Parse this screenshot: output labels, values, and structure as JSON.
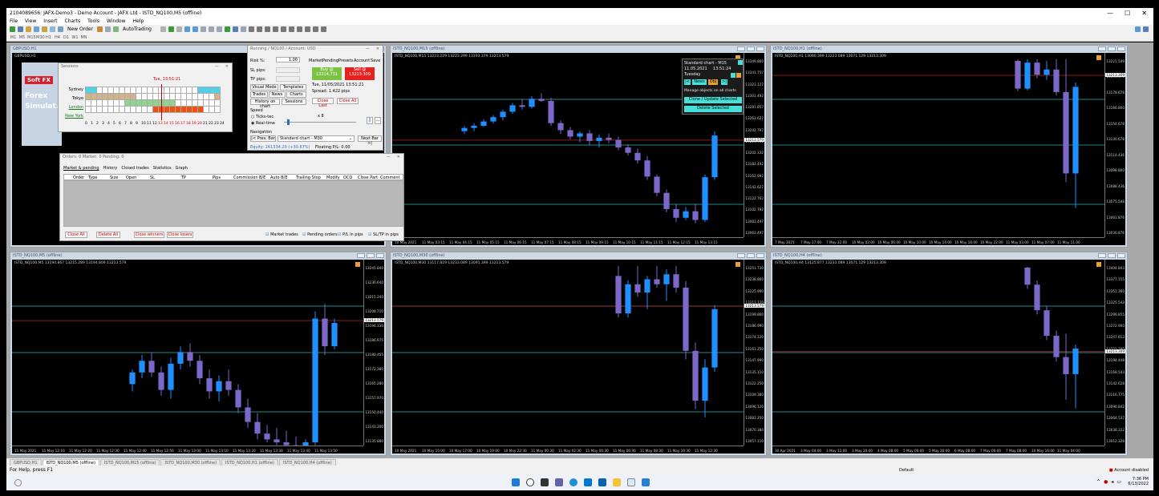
{
  "window": {
    "title": "2104089656: JAFX-Demo3 - Demo Account - JAFX Ltd - ISTD_NQ100,M5 (offline)",
    "btn_min": "—",
    "btn_max": "☐",
    "btn_close": "✕"
  },
  "menu": [
    "File",
    "View",
    "Insert",
    "Charts",
    "Tools",
    "Window",
    "Help"
  ],
  "toolbar": {
    "new_order": "New Order",
    "autotrading": "AutoTrading",
    "timeframes": [
      "M1",
      "M5",
      "M15",
      "M30",
      "H1",
      "H4",
      "D1",
      "W1",
      "MN"
    ]
  },
  "charts": [
    {
      "id": "gbpusd",
      "title": "GBPUSD,H1",
      "label": "GBPUSD,H1"
    },
    {
      "id": "m15",
      "title": "ISTD_NQ100,M15 (offline)",
      "label": "ISTD_NQ100,M15 13223.229 13223.299 13193.379 13213.579",
      "prices": [
        "13349.860",
        "13341.757",
        "13323.127",
        "13301.492",
        "13281.857",
        "13263.627",
        "13242.797",
        "13221.762",
        "13202.332",
        "13182.492",
        "13162.992",
        "13142.627",
        "13122.762",
        "13102.792",
        "13083.497",
        "13063.497"
      ],
      "current_price": "13213.579",
      "times": [
        "10 May 2021",
        "11 May 03:15",
        "11 May 04:15",
        "11 May 05:15",
        "11 May 06:15",
        "11 May 07:15",
        "11 May 08:15",
        "11 May 09:15",
        "11 May 10:15",
        "11 May 11:15",
        "11 May 12:15",
        "11 May 13:15"
      ],
      "y_min": 13040,
      "y_max": 13360,
      "candles": [
        [
          13230,
          13240,
          13225,
          13236
        ],
        [
          13236,
          13245,
          13230,
          13240
        ],
        [
          13240,
          13252,
          13238,
          13248
        ],
        [
          13248,
          13260,
          13244,
          13256
        ],
        [
          13256,
          13270,
          13250,
          13266
        ],
        [
          13266,
          13282,
          13262,
          13278
        ],
        [
          13278,
          13290,
          13270,
          13275
        ],
        [
          13275,
          13295,
          13272,
          13290
        ],
        [
          13290,
          13300,
          13284,
          13286
        ],
        [
          13286,
          13292,
          13240,
          13245
        ],
        [
          13245,
          13250,
          13225,
          13232
        ],
        [
          13232,
          13238,
          13215,
          13220
        ],
        [
          13220,
          13230,
          13210,
          13226
        ],
        [
          13226,
          13232,
          13205,
          13212
        ],
        [
          13212,
          13224,
          13200,
          13218
        ],
        [
          13218,
          13226,
          13208,
          13214
        ],
        [
          13214,
          13220,
          13195,
          13200
        ],
        [
          13200,
          13206,
          13185,
          13190
        ],
        [
          13190,
          13198,
          13170,
          13176
        ],
        [
          13176,
          13184,
          13140,
          13146
        ],
        [
          13146,
          13150,
          13110,
          13116
        ],
        [
          13116,
          13122,
          13080,
          13086
        ],
        [
          13086,
          13094,
          13062,
          13070
        ],
        [
          13070,
          13090,
          13066,
          13082
        ],
        [
          13082,
          13096,
          13060,
          13066
        ],
        [
          13066,
          13150,
          13062,
          13145
        ],
        [
          13145,
          13230,
          13140,
          13222
        ]
      ]
    },
    {
      "id": "h1",
      "title": "ISTD_NQ100,H1 (offline)",
      "label": "ISTD_NQ100,H1 13090.399 13223.089 13071.129 13213.309",
      "prices": [
        "13221.549",
        "13198.678",
        "13178.678",
        "13166.800",
        "13154.678",
        "13140.678",
        "13114.436",
        "13098.800",
        "13088.436",
        "13075.548",
        "13061.876",
        "13030.876"
      ],
      "current_price": "13213.309",
      "times": [
        "7 May 2021",
        "7 May 17:00",
        "7 May 22:00",
        "10 May 02:00",
        "10 May 06:00",
        "10 May 10:00",
        "10 May 14:00",
        "10 May 18:00",
        "10 May 22:00",
        "11 May 03:00",
        "11 May 07:00",
        "11 May 11:00"
      ],
      "y_min": 13030,
      "y_max": 13230,
      "candles": [
        [
          13230,
          13232,
          13195,
          13198
        ],
        [
          13198,
          13232,
          13196,
          13228
        ],
        [
          13228,
          13232,
          13210,
          13214
        ],
        [
          13214,
          13230,
          13208,
          13220
        ],
        [
          13220,
          13232,
          13190,
          13194
        ],
        [
          13194,
          13232,
          13090,
          13100
        ],
        [
          13100,
          13205,
          13060,
          13200
        ]
      ]
    },
    {
      "id": "m5",
      "title": "ISTD_NQ100,M5 (offline)",
      "label": "ISTD_NQ100,M5 13194.867 13215.289 13194.809 13213.579",
      "prices": [
        "13245.840",
        "13230.640",
        "13215.240",
        "13208.710",
        "13194.330",
        "13186.975",
        "13180.455",
        "13172.380",
        "13165.280",
        "13157.970",
        "13150.440",
        "13143.200",
        "13135.880"
      ],
      "current_price": "13213.579",
      "times": [
        "11 May 2021",
        "11 May 12:10",
        "11 May 12:20",
        "11 May 12:30",
        "11 May 12:40",
        "11 May 12:50",
        "11 May 13:00",
        "11 May 13:10",
        "11 May 13:20",
        "11 May 13:30",
        "11 May 13:40",
        "11 May 13:50"
      ],
      "y_min": 13130,
      "y_max": 13250,
      "candles": [
        [
          13170,
          13180,
          13165,
          13178
        ],
        [
          13178,
          13190,
          13174,
          13186
        ],
        [
          13186,
          13192,
          13175,
          13178
        ],
        [
          13178,
          13182,
          13162,
          13166
        ],
        [
          13166,
          13188,
          13160,
          13184
        ],
        [
          13184,
          13196,
          13180,
          13192
        ],
        [
          13192,
          13198,
          13182,
          13186
        ],
        [
          13186,
          13190,
          13170,
          13174
        ],
        [
          13174,
          13180,
          13160,
          13165
        ],
        [
          13165,
          13176,
          13158,
          13172
        ],
        [
          13172,
          13180,
          13162,
          13166
        ],
        [
          13166,
          13170,
          13150,
          13154
        ],
        [
          13154,
          13160,
          13140,
          13144
        ],
        [
          13144,
          13150,
          13132,
          13136
        ],
        [
          13136,
          13142,
          13130,
          13132
        ],
        [
          13132,
          13140,
          13128,
          13130
        ],
        [
          13130,
          13138,
          13126,
          13128
        ],
        [
          13128,
          13134,
          13125,
          13127
        ],
        [
          13127,
          13132,
          13125,
          13130
        ],
        [
          13130,
          13220,
          13128,
          13215
        ],
        [
          13215,
          13225,
          13190,
          13196
        ],
        [
          13196,
          13215,
          13194,
          13212
        ]
      ]
    },
    {
      "id": "m30",
      "title": "ISTD_NQ100,M30 (offline)",
      "label": "ISTD_NQ100,M30 13117.819 13233.089 13091.399 13213.579",
      "prices": [
        "13251.730",
        "13238.860",
        "13225.990",
        "13213.120",
        "13199.860",
        "13186.990",
        "13174.120",
        "13161.250",
        "13147.990",
        "13135.110",
        "13122.250",
        "13109.380",
        "13096.120",
        "13083.250",
        "13070.380",
        "13057.110"
      ],
      "current_price": "13213.579",
      "times": [
        "10 May 2021",
        "10 May 15:00",
        "10 May 17:00",
        "10 May 19:00",
        "10 May 22:30",
        "11 May 00:30",
        "11 May 02:30",
        "11 May 04:30",
        "11 May 06:30",
        "11 May 08:30",
        "11 May 10:30",
        "11 May 12:30"
      ],
      "y_min": 13050,
      "y_max": 13260,
      "candles": [
        [
          13250,
          13262,
          13200,
          13205
        ],
        [
          13205,
          13245,
          13200,
          13240
        ],
        [
          13240,
          13262,
          13225,
          13230
        ],
        [
          13230,
          13250,
          13210,
          13246
        ],
        [
          13246,
          13262,
          13236,
          13240
        ],
        [
          13240,
          13258,
          13220,
          13252
        ],
        [
          13252,
          13262,
          13230,
          13236
        ],
        [
          13236,
          13244,
          13150,
          13160
        ],
        [
          13160,
          13170,
          13090,
          13100
        ],
        [
          13100,
          13150,
          13080,
          13140
        ],
        [
          13140,
          13215,
          13135,
          13210
        ]
      ]
    },
    {
      "id": "h4",
      "title": "ISTD_NQ100,H4 (offline)",
      "label": "ISTD_NQ100,H4 13125.877 13233.089 13071.129 13213.309",
      "prices": [
        "13404.843",
        "13377.155",
        "13351.360",
        "13325.543",
        "13299.855",
        "13272.900",
        "13247.813",
        "13221.180",
        "13194.448",
        "13168.543",
        "13142.628",
        "13116.775",
        "13090.842",
        "13064.537",
        "13038.222",
        "13012.328"
      ],
      "current_price": "13213.309",
      "times": [
        "30 Apr 2021",
        "3 May 04:00",
        "3 May 12:00",
        "3 May 20:00",
        "4 May 08:00",
        "5 May 00:00",
        "5 May 16:00",
        "6 May 08:00",
        "7 May 00:00",
        "7 May 08:00",
        "10 May 16:00",
        "11 May 04:00"
      ],
      "y_min": 13000,
      "y_max": 13410,
      "candles": [
        [
          13410,
          13412,
          13360,
          13370
        ],
        [
          13370,
          13380,
          13300,
          13310
        ],
        [
          13310,
          13320,
          13240,
          13250
        ],
        [
          13250,
          13262,
          13190,
          13200
        ],
        [
          13200,
          13255,
          13100,
          13160
        ],
        [
          13160,
          13230,
          13080,
          13220
        ]
      ]
    }
  ],
  "sessions": {
    "title": "Sessions",
    "time": "Tue, 13:51:21",
    "rows": [
      "Sydney",
      "Tokyo",
      "London",
      "New York"
    ],
    "hours": [
      "0",
      "1",
      "2",
      "3",
      "4",
      "5",
      "6",
      "7",
      "8",
      "9",
      "10",
      "11",
      "12",
      "13",
      "14",
      "15",
      "16",
      "17",
      "18",
      "19",
      "20",
      "21",
      "22",
      "23",
      "24"
    ],
    "logo": "Soft FX",
    "logo2": "Forex Simulat..."
  },
  "trading": {
    "title": "Running / NQ100 / Account: USD",
    "risk_lbl": "Risk %:",
    "risk_val": "1.00",
    "sl_lbl": "SL pips:",
    "tp_lbl": "TP pips:",
    "tabs": [
      "Market",
      "Pending",
      "Presets",
      "Account",
      "Save"
    ],
    "buy": "Buy @",
    "buy_price": "13214.731",
    "sell": "Sell @",
    "sell_price": "13213.309",
    "date": "Tue, 11/05/2021 13:51:21",
    "spread": "Spread: 1.422 pips",
    "btns": [
      "Visual Mode",
      "Templates",
      "Trades",
      "News",
      "Charts",
      "History on chart",
      "Sessions"
    ],
    "close_last": "Close Last",
    "close_all": "Close All",
    "speed": "Speed",
    "ticks": "Ticks-tec",
    "realtime": "Real-time",
    "speed_x": "x 8",
    "nav": "Navigation",
    "prev": "|< Prev. Bar",
    "nav_sel": "Standard chart - M30",
    "next": "Next Bar >|",
    "equity": "Equity: 261334.20 (+30.67%)",
    "floating": "Floating P/L: 0.00"
  },
  "orders": {
    "title": "Orders: 0   Market: 0   Pending: 0",
    "tabs": [
      "Market & pending",
      "History",
      "Closed trades",
      "Statistics",
      "Graph"
    ],
    "cols": [
      "Order",
      "Type",
      "Size",
      "Open",
      "SL",
      "TP",
      "Pips",
      "Commission",
      "B/E",
      "Auto B/E",
      "Trailing Stop",
      "Modify",
      "OCO",
      "Close Part",
      "Comment"
    ],
    "close_all": "Close All",
    "delete_all": "Delete All",
    "close_winners": "Close winners",
    "close_losers": "Close losers",
    "checks": [
      "Market trades",
      "Pending orders",
      "P/L in pips",
      "SL/TP in pips"
    ]
  },
  "standard": {
    "title": "Standard chart - M15",
    "date": "11.05.2021",
    "time": "13:51:24",
    "day": "Tuesday",
    "news": "News",
    "obj": "Obj",
    "manage": "Manage objects on all charts",
    "clone": "Clone / Update Selected",
    "delete": "Delete Selected"
  },
  "tabs": [
    "GBPUSD,H1",
    "ISTD_NQ100,M5 (offline)",
    "ISTD_NQ100,M15 (offline)",
    "ISTD_NQ100,M30 (offline)",
    "ISTD_NQ100,H1 (offline)",
    "ISTD_NQ100,H4 (offline)"
  ],
  "status": {
    "help": "For Help, press F1",
    "profile": "Default",
    "account": "Account disabled"
  },
  "taskbar": {
    "time": "7:36 PM",
    "date": "6/13/2022"
  },
  "colors": {
    "bull": "#1e90ff",
    "bear": "#7b68c8",
    "grid": "#1e8a8a",
    "price": "#8b1a1a"
  }
}
